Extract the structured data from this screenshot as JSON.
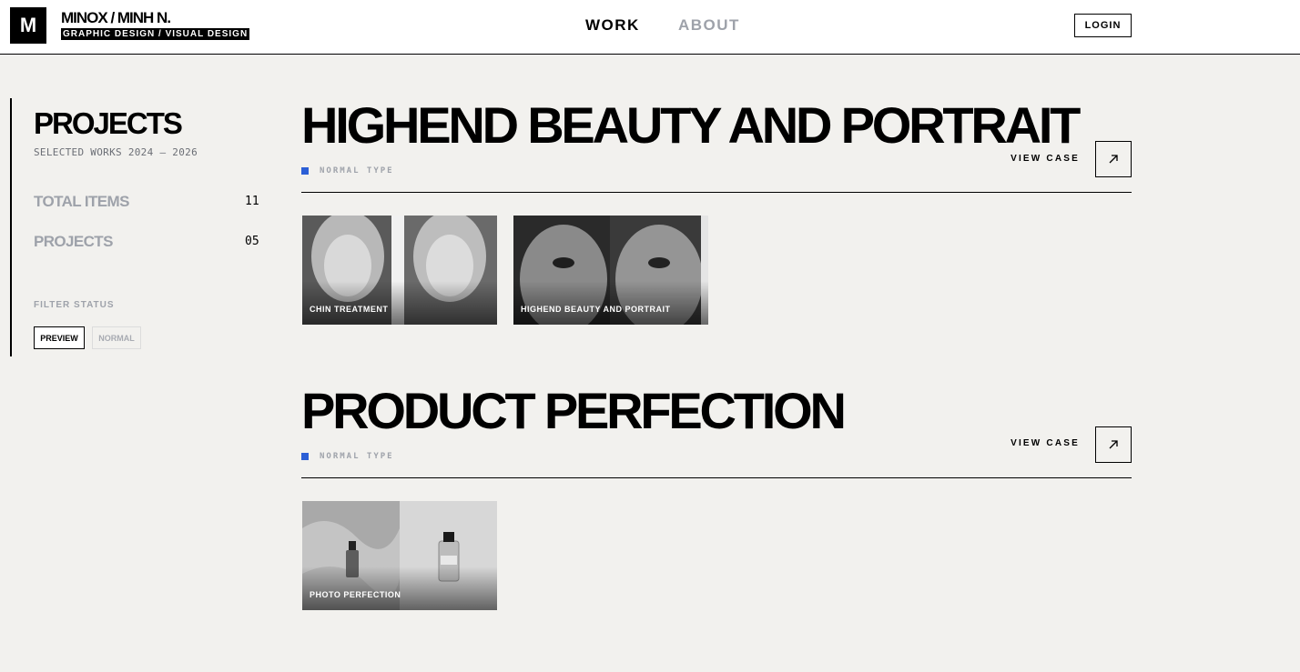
{
  "header": {
    "logo_letter": "M",
    "brand_name": "MINOX / MINH N.",
    "brand_tag": "GRAPHIC DESIGN / VISUAL DESIGN",
    "nav": {
      "work": "WORK",
      "about": "ABOUT"
    },
    "login_label": "LOGIN"
  },
  "sidebar": {
    "title": "PROJECTS",
    "subtitle": "SELECTED WORKS 2024 — 2026",
    "stats": [
      {
        "label": "TOTAL ITEMS",
        "value": "11"
      },
      {
        "label": "PROJECTS",
        "value": "05"
      }
    ],
    "filter_label": "FILTER STATUS",
    "filters": [
      {
        "label": "PREVIEW",
        "active": true
      },
      {
        "label": "NORMAL",
        "active": false
      }
    ]
  },
  "projects": [
    {
      "title": "HIGHEND BEAUTY AND PORTRAIT",
      "type_label": "NORMAL TYPE",
      "type_color": "#2c5fd6",
      "view_case_label": "VIEW CASE",
      "items": [
        {
          "caption": "CHIN TREATMENT"
        },
        {
          "caption": "HIGHEND BEAUTY AND PORTRAIT"
        }
      ]
    },
    {
      "title": "PRODUCT PERFECTION",
      "type_label": "NORMAL TYPE",
      "type_color": "#2c5fd6",
      "view_case_label": "VIEW CASE",
      "items": [
        {
          "caption": "PHOTO PERFECTION"
        }
      ]
    }
  ],
  "icons": {
    "arrow": "arrow-up-right-icon"
  }
}
